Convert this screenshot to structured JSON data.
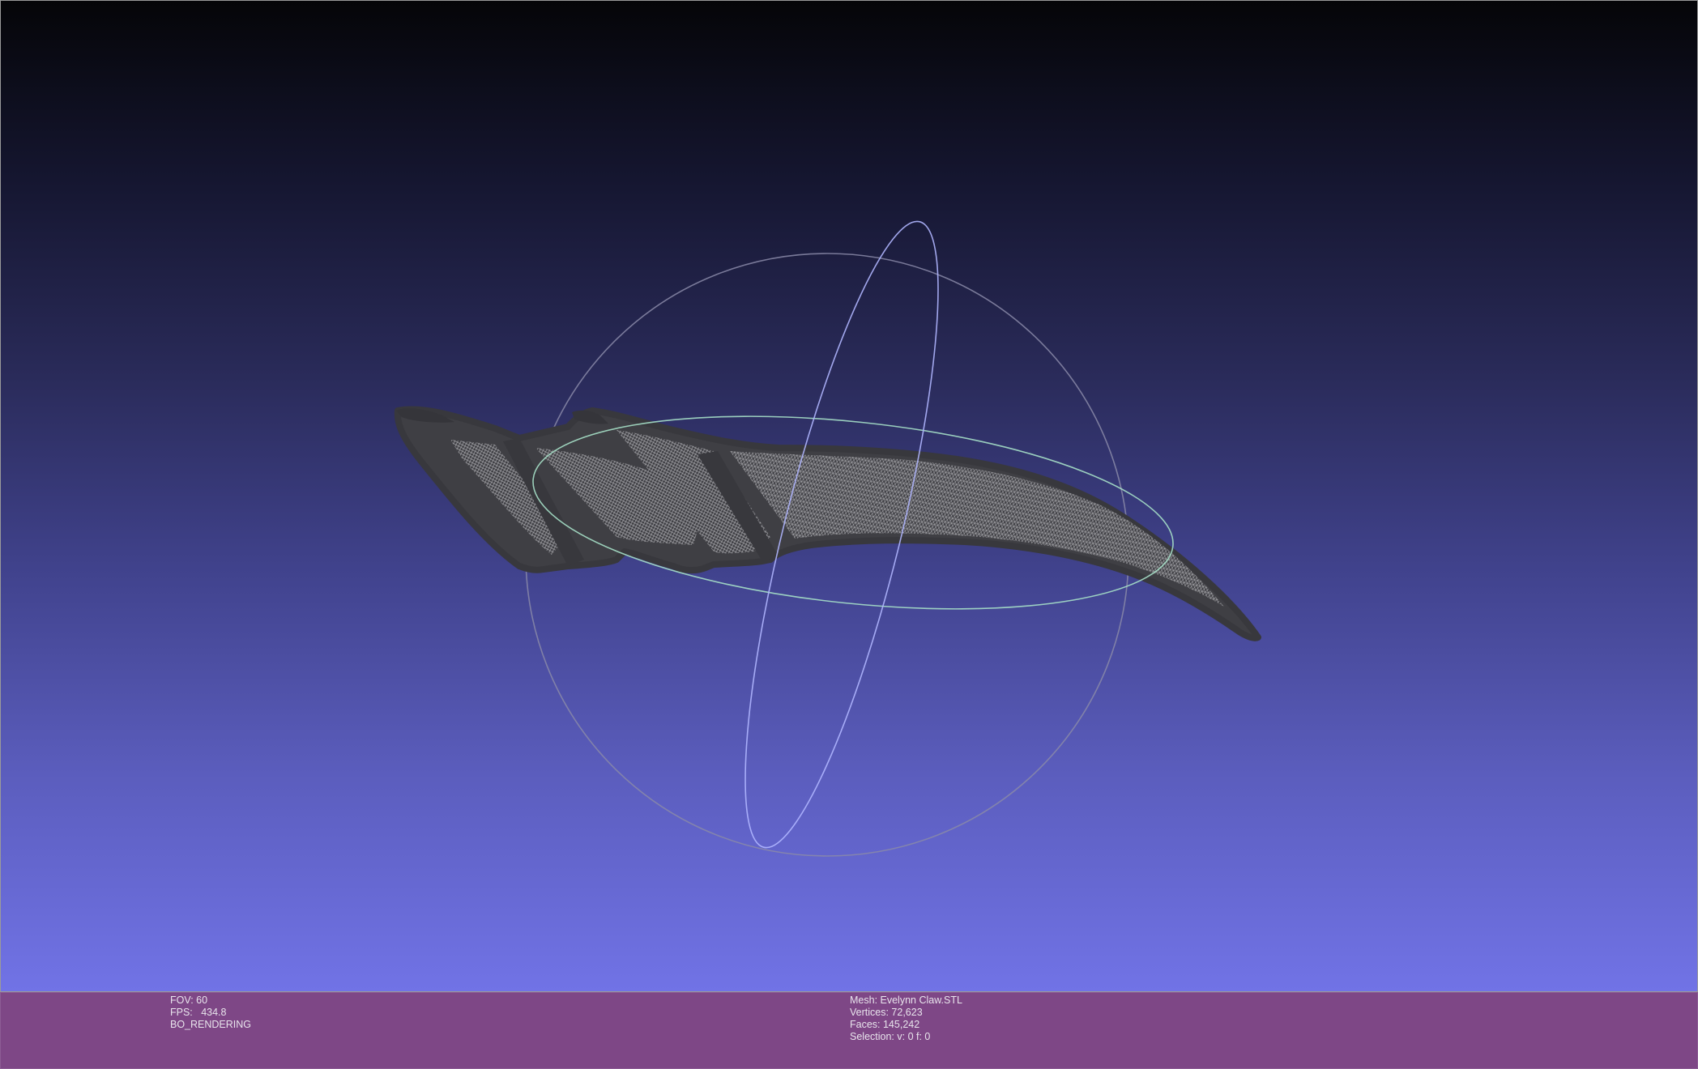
{
  "colors": {
    "viewport_top": "#050508",
    "viewport_bottom": "#7173e6",
    "infobar_bg": "#7e4786",
    "info_text": "#e8e4ec",
    "mesh_fill": "#3f3f44",
    "mesh_wire": "#c8c8cc",
    "trackball_gray": "#8a8aa8",
    "trackball_green": "#a6e0c8",
    "trackball_blue": "#b0b6ff"
  },
  "icons": {
    "trackball": "trackball-gizmo",
    "mesh": "claw-mesh"
  },
  "infobar": {
    "left": {
      "fov": "FOV: 60",
      "fps": "FPS:   434.8",
      "render_mode": "BO_RENDERING"
    },
    "right": {
      "mesh": "Mesh: Evelynn Claw.STL",
      "vertices": "Vertices: 72,623",
      "faces": "Faces: 145,242",
      "selection": "Selection: v: 0 f: 0"
    }
  }
}
